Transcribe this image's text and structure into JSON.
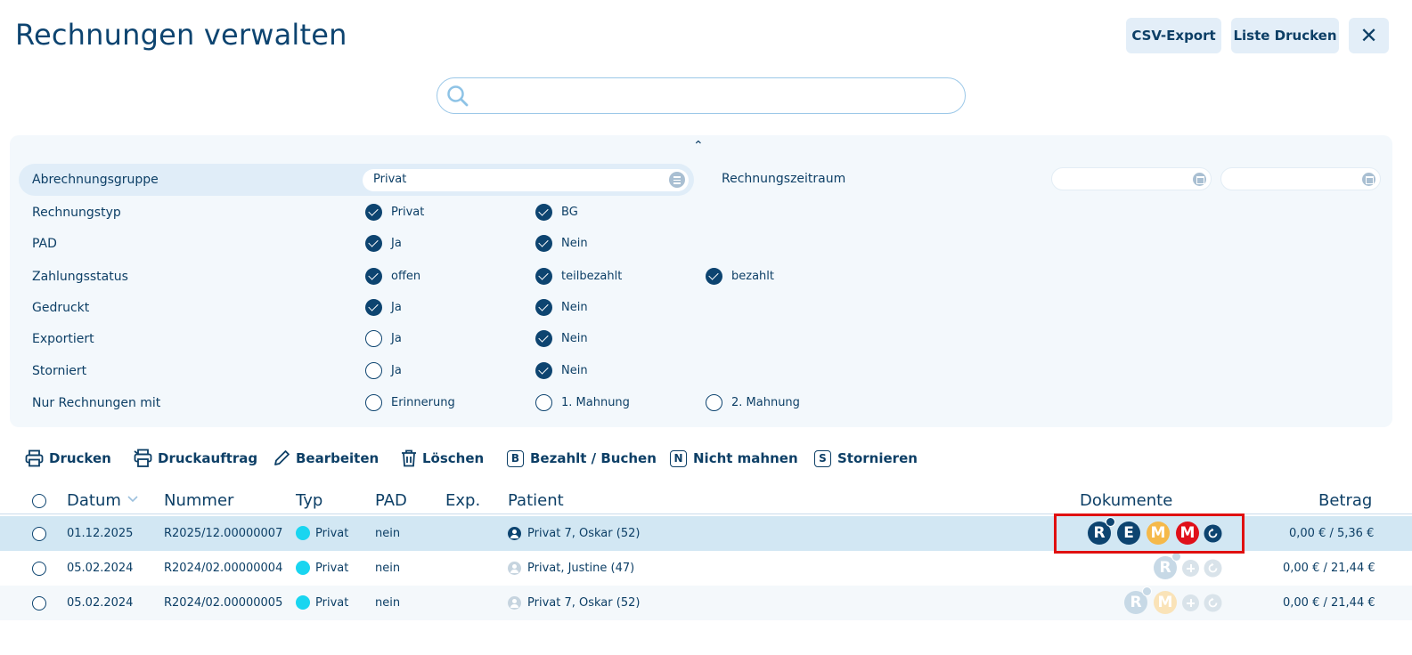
{
  "page": {
    "title": "Rechnungen verwalten"
  },
  "toolbar": {
    "csv_export": "CSV-Export",
    "print_list": "Liste Drucken",
    "close": "✕"
  },
  "search": {
    "value": "",
    "placeholder": ""
  },
  "filters": {
    "group": {
      "label": "Abrechnungsgruppe",
      "value": "Privat"
    },
    "period": {
      "label": "Rechnungszeitraum",
      "from": "",
      "to": ""
    },
    "rows": [
      {
        "label": "Rechnungstyp",
        "options": [
          {
            "label": "Privat",
            "checked": true
          },
          {
            "label": "BG",
            "checked": true
          }
        ]
      },
      {
        "label": "PAD",
        "options": [
          {
            "label": "Ja",
            "checked": true
          },
          {
            "label": "Nein",
            "checked": true
          }
        ]
      },
      {
        "label": "Zahlungsstatus",
        "options": [
          {
            "label": "offen",
            "checked": true
          },
          {
            "label": "teilbezahlt",
            "checked": true
          },
          {
            "label": "bezahlt",
            "checked": true
          }
        ]
      },
      {
        "label": "Gedruckt",
        "options": [
          {
            "label": "Ja",
            "checked": true
          },
          {
            "label": "Nein",
            "checked": true
          }
        ]
      },
      {
        "label": "Exportiert",
        "options": [
          {
            "label": "Ja",
            "checked": false
          },
          {
            "label": "Nein",
            "checked": true
          }
        ]
      },
      {
        "label": "Storniert",
        "options": [
          {
            "label": "Ja",
            "checked": false
          },
          {
            "label": "Nein",
            "checked": true
          }
        ]
      },
      {
        "label": "Nur Rechnungen mit",
        "options": [
          {
            "label": "Erinnerung",
            "checked": false
          },
          {
            "label": "1. Mahnung",
            "checked": false
          },
          {
            "label": "2. Mahnung",
            "checked": false
          }
        ]
      }
    ]
  },
  "actions": {
    "print": "Drucken",
    "print_job": "Druckauftrag",
    "edit": "Bearbeiten",
    "delete": "Löschen",
    "paid": "Bezahlt / Buchen",
    "paid_key": "B",
    "no_dunning": "Nicht mahnen",
    "no_dunning_key": "N",
    "cancel": "Stornieren",
    "cancel_key": "S"
  },
  "table": {
    "headers": {
      "date": "Datum",
      "number": "Nummer",
      "type": "Typ",
      "pad": "PAD",
      "exp": "Exp.",
      "patient": "Patient",
      "documents": "Dokumente",
      "amount": "Betrag"
    },
    "rows": [
      {
        "date": "01.12.2025",
        "number": "R2025/12.00000007",
        "type": "Privat",
        "pad": "nein",
        "exp": "",
        "patient": "Privat 7, Oskar (52)",
        "amount": "0,00 € / 5,36 €",
        "selected": true,
        "documents": [
          "R",
          "E",
          "M",
          "M"
        ]
      },
      {
        "date": "05.02.2024",
        "number": "R2024/02.00000004",
        "type": "Privat",
        "pad": "nein",
        "exp": "",
        "patient": "Privat, Justine (47)",
        "amount": "0,00 € / 21,44 €",
        "selected": false,
        "documents": [
          "R"
        ]
      },
      {
        "date": "05.02.2024",
        "number": "R2024/02.00000005",
        "type": "Privat",
        "pad": "nein",
        "exp": "",
        "patient": "Privat 7, Oskar (52)",
        "amount": "0,00 € / 21,44 €",
        "selected": false,
        "documents": [
          "R",
          "M"
        ]
      }
    ]
  },
  "colors": {
    "primary": "#0d4470",
    "type_dot": "#19d5f0",
    "doc_orange": "#f5b94a",
    "doc_red": "#e0101a",
    "highlight": "#e01010"
  }
}
